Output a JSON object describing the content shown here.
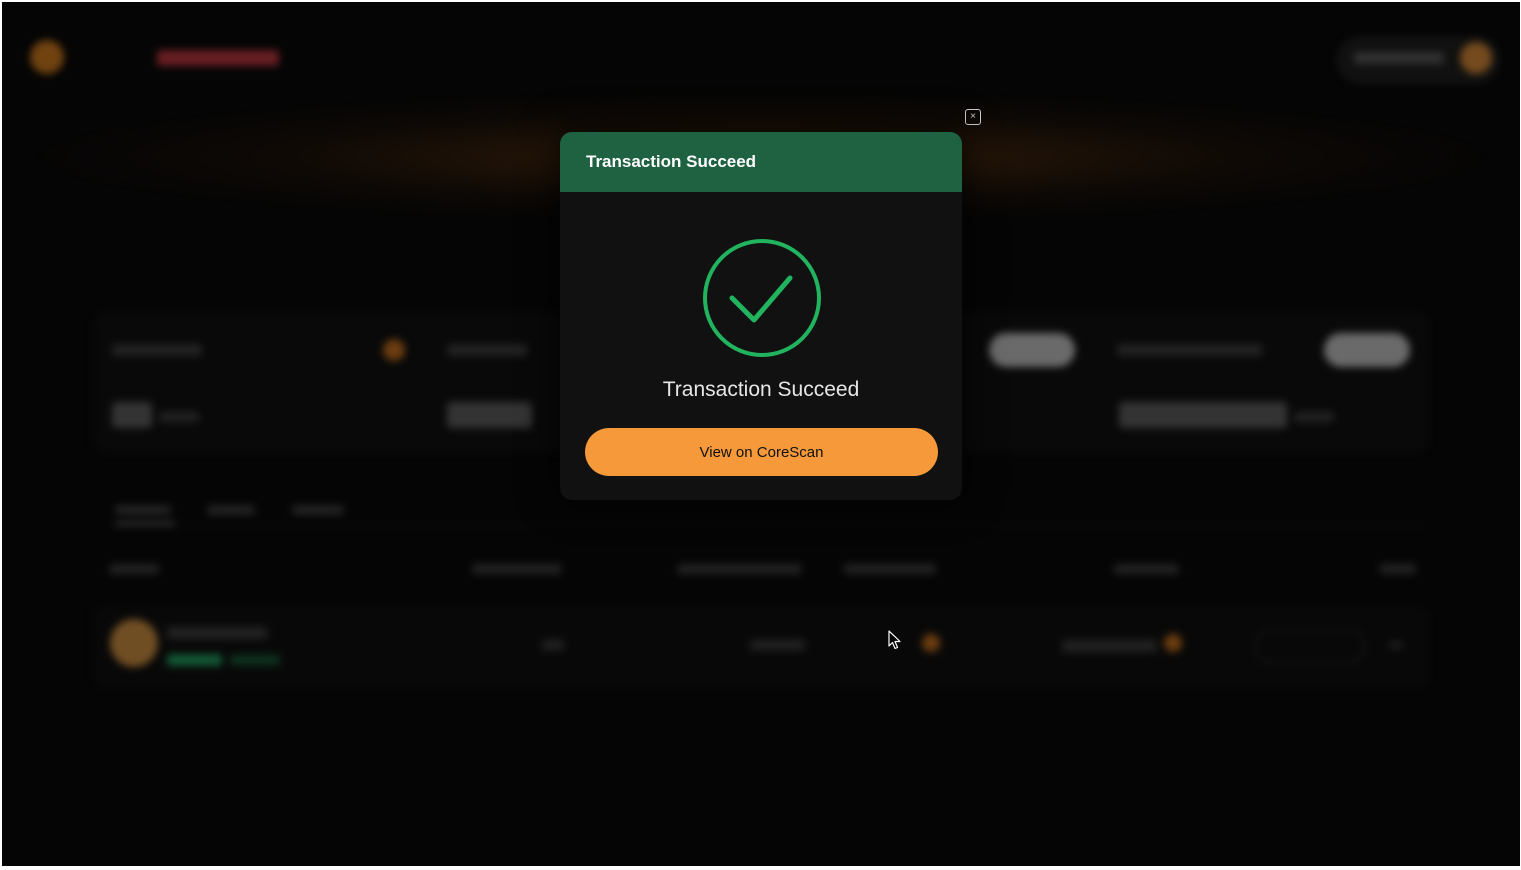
{
  "modal": {
    "title": "Transaction Succeed",
    "message": "Transaction Succeed",
    "button_label": "View on CoreScan",
    "close_glyph": "×",
    "colors": {
      "header": "#1e6241",
      "check": "#22b35f",
      "button": "#f5993b"
    }
  },
  "icons": {
    "close": "close-icon",
    "success": "check-circle-icon",
    "cursor": "mouse-pointer-icon"
  }
}
